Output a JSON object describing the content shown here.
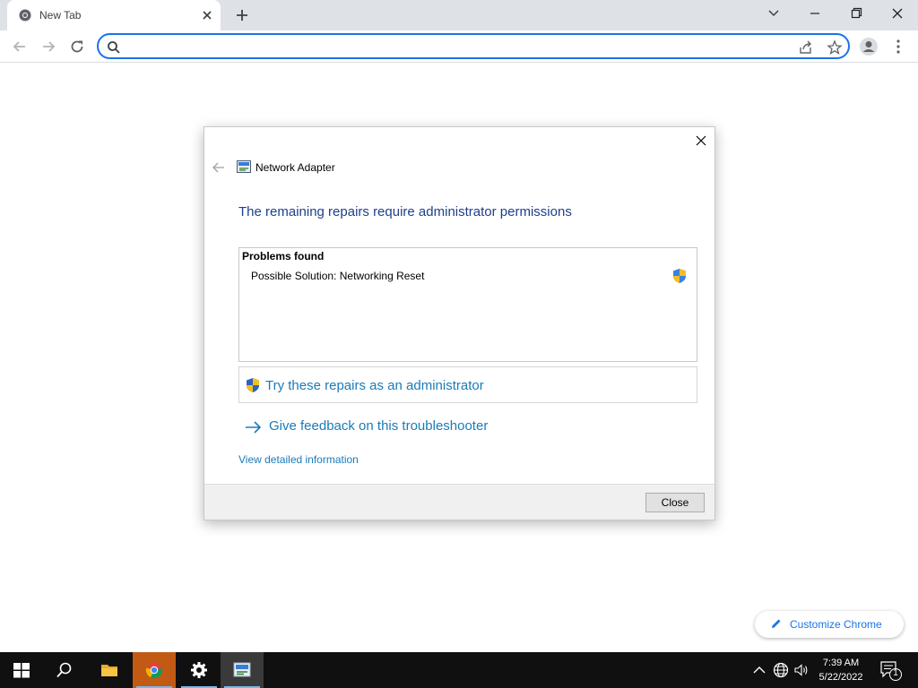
{
  "browser": {
    "tab_title": "New Tab",
    "omnibox_value": ""
  },
  "dialog": {
    "app_title": "Network Adapter",
    "heading": "The remaining repairs require administrator permissions",
    "problems_title": "Problems found",
    "problems": [
      {
        "label": "Possible Solution: Networking Reset"
      }
    ],
    "try_repairs_label": "Try these repairs as an administrator",
    "feedback_label": "Give feedback on this troubleshooter",
    "details_label": "View detailed information",
    "close_label": "Close"
  },
  "customize_chrome_label": "Customize Chrome",
  "taskbar": {
    "time": "7:39 AM",
    "date": "5/22/2022",
    "notification_count": "1"
  },
  "colors": {
    "accent": "#1a73e8",
    "heading": "#1e3f8c",
    "link": "#1a7bb8",
    "taskbar": "#101010"
  }
}
